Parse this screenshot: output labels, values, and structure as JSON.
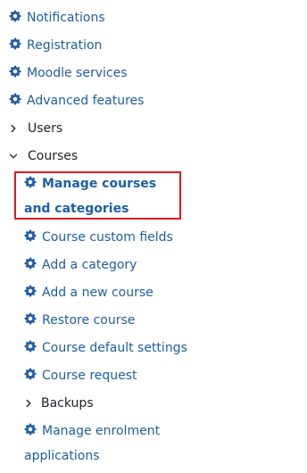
{
  "nav": {
    "items": [
      {
        "label": "Notifications",
        "icon": "gear-icon"
      },
      {
        "label": "Registration",
        "icon": "gear-icon"
      },
      {
        "label": "Moodle services",
        "icon": "gear-icon"
      },
      {
        "label": "Advanced features",
        "icon": "gear-icon"
      },
      {
        "label": "Users",
        "icon": "chevron-right-icon",
        "state": "collapsed"
      },
      {
        "label": "Courses",
        "icon": "chevron-down-icon",
        "state": "expanded"
      }
    ],
    "courses_children": [
      {
        "label": "Manage courses and categories",
        "icon": "gear-icon",
        "selected": true
      },
      {
        "label": "Course custom fields",
        "icon": "gear-icon"
      },
      {
        "label": "Add a category",
        "icon": "gear-icon"
      },
      {
        "label": "Add a new course",
        "icon": "gear-icon"
      },
      {
        "label": "Restore course",
        "icon": "gear-icon"
      },
      {
        "label": "Course default settings",
        "icon": "gear-icon"
      },
      {
        "label": "Course request",
        "icon": "gear-icon"
      },
      {
        "label": "Backups",
        "icon": "chevron-right-icon",
        "state": "collapsed"
      },
      {
        "label": "Manage enrolment applications",
        "icon": "gear-icon"
      }
    ]
  },
  "colors": {
    "link": "#1f5da6",
    "text": "#1d2125",
    "highlight_border": "#e0191e"
  }
}
